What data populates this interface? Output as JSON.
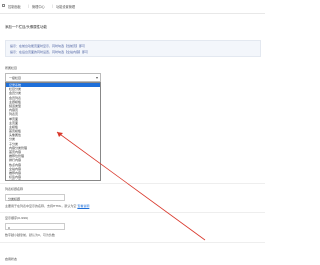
{
  "breadcrumb": {
    "items": [
      "控制面板",
      "管理中心",
      "功能设置管理"
    ]
  },
  "title": "添加一个栏目/头像属性功能",
  "tips": {
    "line1": "提示：在前台功能页面时显示，同时勾选【当前页】即可",
    "line2": "提示：在后台页面的同时设置，同时勾选【全站内容】即可"
  },
  "type_field": {
    "label": "所属栏目",
    "selected": "一级栏目",
    "options": [
      "记录系统",
      "栏目分类",
      "会员分类",
      "会员列表",
      "主题模板",
      "频道类型",
      "内容页",
      "列表页",
      "单页面",
      "主页面",
      "主模板",
      "首页模板",
      "头像属性",
      "分类",
      "子分类",
      "内容分类管理",
      "首页内容",
      "推荐位管理",
      "排行内容",
      "热点内容",
      "全站内容",
      "推荐内容",
      "标签内容",
      "关联内容"
    ],
    "highlighted_index": 0
  },
  "alt_title": {
    "label": "列表标题名称",
    "value": "分类标题",
    "help": "主要用于在列表中显示的名称，支持HTML，默认为空",
    "help_link": "查看说明"
  },
  "sort_field": {
    "label": "显示顺序(0-999)",
    "value": "0",
    "help": "数字越小越靠前，默认为0，可为负数"
  },
  "bottom_label": "启用状态",
  "colors": {
    "selected": "#1e6fd9",
    "arrow": "#d9382b",
    "tip_bg": "#f3f6fb"
  }
}
